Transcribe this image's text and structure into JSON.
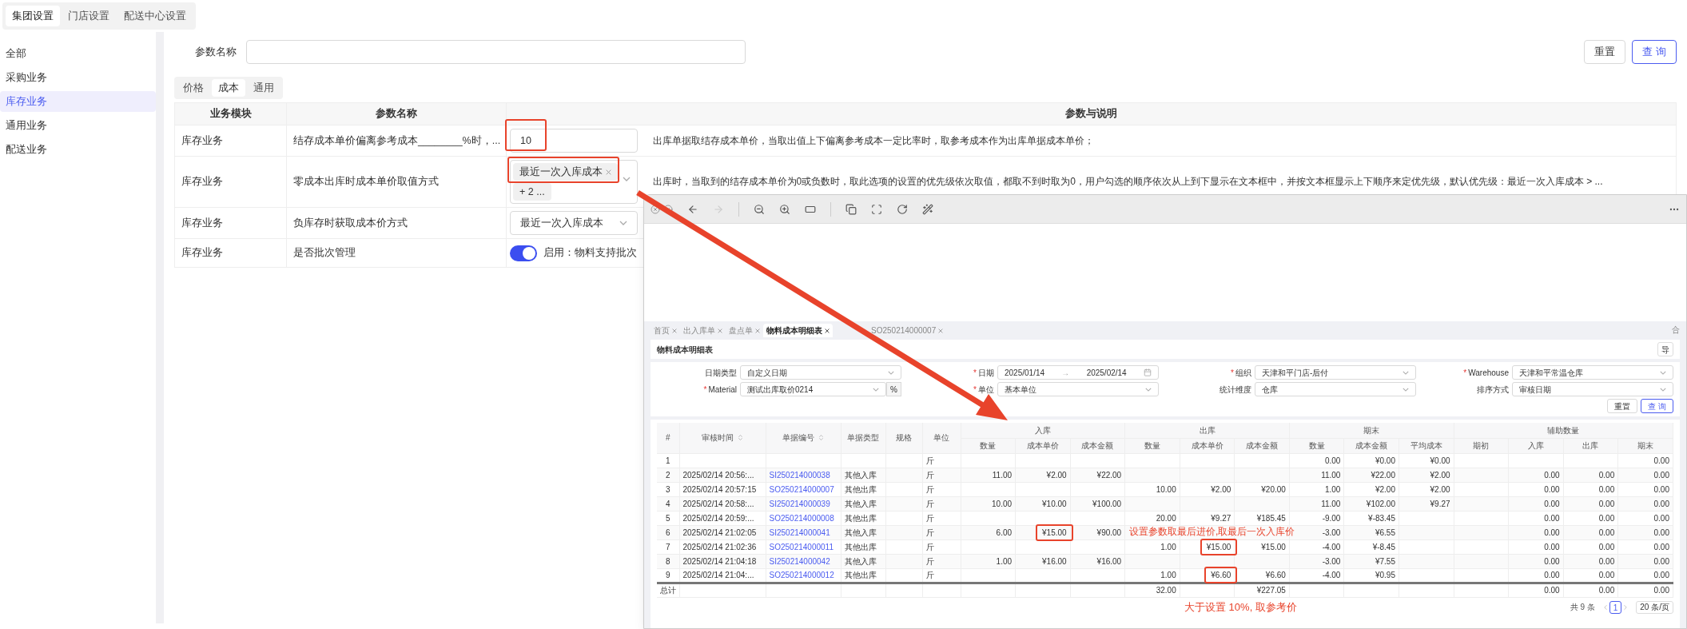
{
  "top_tabs": [
    {
      "label": "集团设置",
      "selected": true
    },
    {
      "label": "门店设置",
      "selected": false
    },
    {
      "label": "配送中心设置",
      "selected": false
    }
  ],
  "sidebar": {
    "items": [
      {
        "label": "全部",
        "selected": false
      },
      {
        "label": "采购业务",
        "selected": false
      },
      {
        "label": "库存业务",
        "selected": true
      },
      {
        "label": "通用业务",
        "selected": false
      },
      {
        "label": "配送业务",
        "selected": false
      }
    ]
  },
  "search": {
    "label": "参数名称",
    "buttons": [
      {
        "label": "重置",
        "kind": "default"
      },
      {
        "label": "查 询",
        "kind": "primary"
      }
    ]
  },
  "sub_tabs": [
    {
      "label": "价格",
      "selected": false
    },
    {
      "label": "成本",
      "selected": true
    },
    {
      "label": "通用",
      "selected": false
    }
  ],
  "params_table": {
    "columns": [
      "业务模块",
      "参数名称",
      "参数与说明"
    ],
    "rows": [
      {
        "module": "库存业务",
        "name": "结存成本单价偏离参考成本________%时，...",
        "control": {
          "kind": "input",
          "value": "10",
          "highlighted": true
        },
        "description": "出库单据取结存成本单价，当取出值上下偏离参考成本一定比率时，取参考成本作为出库单据成本单价；"
      },
      {
        "module": "库存业务",
        "name": "零成本出库时成本单价取值方式",
        "control": {
          "kind": "multiselect",
          "tags": [
            "最近一次入库成本"
          ],
          "more": "+ 2 ...",
          "highlighted": true
        },
        "description": "出库时，当取到的结存成本单价为0或负数时，取此选项的设置的优先级依次取值，都取不到时取为0，用户勾选的顺序依次从上到下显示在文本框中，并按文本框显示上下顺序来定优先级，默认优先级：最近一次入库成本 > ..."
      },
      {
        "module": "库存业务",
        "name": "负库存时获取成本价方式",
        "control": {
          "kind": "select",
          "value": "最近一次入库成本",
          "highlighted": false
        }
      },
      {
        "module": "库存业务",
        "name": "是否批次管理",
        "control": {
          "kind": "switch",
          "on": true,
          "label": "启用：物料支持批次",
          "highlighted": false
        }
      }
    ]
  },
  "viewer": {
    "report": {
      "tabs": [
        {
          "label": "首页",
          "selected": false
        },
        {
          "label": "出入库单",
          "selected": false
        },
        {
          "label": "盘点单",
          "selected": false
        },
        {
          "label": "物料成本明细表",
          "selected": true
        },
        {
          "label": "SO250214000007",
          "selected": false
        }
      ],
      "tab_bar_button": "合",
      "title": "物料成本明细表",
      "export_button": "导",
      "filters": [
        {
          "label": "日期类型",
          "required": false,
          "kind": "select",
          "value": "自定义日期"
        },
        {
          "label": "日期",
          "required": true,
          "required_mark": "*",
          "kind": "range",
          "from": "2025/01/14",
          "separator": "→",
          "to": "2025/02/14"
        },
        {
          "label": "组织",
          "required": true,
          "required_mark": "*",
          "kind": "select",
          "value": "天津和平门店-后付"
        },
        {
          "label": "Warehouse",
          "required": true,
          "required_mark": "*",
          "kind": "select",
          "value": "天津和平常温仓库"
        },
        {
          "label": "Material",
          "required": true,
          "required_mark": "*",
          "kind": "select",
          "value": "测试出库取价0214",
          "suffix": "%"
        },
        {
          "label": "单位",
          "required": true,
          "required_mark": "*",
          "kind": "select",
          "value": "基本单位"
        },
        {
          "label": "统计维度",
          "required": false,
          "kind": "select",
          "value": "仓库"
        },
        {
          "label": "排序方式",
          "required": false,
          "kind": "select",
          "value": "审核日期"
        }
      ],
      "buttons": [
        {
          "label": "重置",
          "kind": "default"
        },
        {
          "label": "查 询",
          "kind": "primary"
        }
      ],
      "table": {
        "columns": [
          {
            "label": "#",
            "kind": "index",
            "sortable": false
          },
          {
            "label": "审核时间",
            "kind": "text",
            "sortable": true
          },
          {
            "label": "单据编号",
            "kind": "link",
            "sortable": true
          },
          {
            "label": "单据类型",
            "kind": "text",
            "sortable": false
          },
          {
            "label": "规格",
            "kind": "text",
            "sortable": false
          },
          {
            "label": "单位",
            "kind": "unit",
            "sortable": false
          },
          {
            "label": "入库",
            "kind": "group",
            "colspan": 3,
            "sortable": false,
            "children": [
              "数量",
              "成本单价",
              "成本金额"
            ]
          },
          {
            "label": "出库",
            "kind": "group",
            "colspan": 3,
            "sortable": false,
            "children": [
              "数量",
              "成本单价",
              "成本金额"
            ]
          },
          {
            "label": "期末",
            "kind": "group",
            "colspan": 3,
            "sortable": false,
            "children": [
              "数量",
              "成本金额",
              "平均成本"
            ]
          },
          {
            "label": "辅助数量",
            "kind": "group",
            "colspan": 4,
            "sortable": false,
            "children": [
              "期初",
              "入库",
              "出库",
              "期末"
            ]
          }
        ],
        "rows": [
          [
            "1",
            null,
            null,
            null,
            null,
            "斤",
            null,
            null,
            null,
            null,
            null,
            null,
            "0.00",
            "¥0.00",
            "¥0.00",
            null,
            null,
            null,
            "0.00"
          ],
          [
            "2",
            "2025/02/14 20:56:...",
            "SI250214000038",
            "其他入库",
            null,
            "斤",
            "11.00",
            "¥2.00",
            "¥22.00",
            null,
            null,
            null,
            "11.00",
            "¥22.00",
            "¥2.00",
            null,
            "0.00",
            "0.00",
            "0.00"
          ],
          [
            "3",
            "2025/02/14 20:57:15",
            "SO250214000007",
            "其他出库",
            null,
            "斤",
            null,
            null,
            null,
            "10.00",
            "¥2.00",
            "¥20.00",
            "1.00",
            "¥2.00",
            "¥2.00",
            null,
            "0.00",
            "0.00",
            "0.00"
          ],
          [
            "4",
            "2025/02/14 20:58:...",
            "SI250214000039",
            "其他入库",
            null,
            "斤",
            "10.00",
            "¥10.00",
            "¥100.00",
            null,
            null,
            null,
            "11.00",
            "¥102.00",
            "¥9.27",
            null,
            "0.00",
            "0.00",
            "0.00"
          ],
          [
            "5",
            "2025/02/14 20:59:...",
            "SO250214000008",
            "其他出库",
            null,
            "斤",
            null,
            null,
            null,
            "20.00",
            "¥9.27",
            "¥185.45",
            "-9.00",
            "¥-83.45",
            null,
            null,
            "0.00",
            "0.00",
            "0.00"
          ],
          [
            "6",
            "2025/02/14 21:02:05",
            "SI250214000041",
            "其他入库",
            null,
            "斤",
            "6.00",
            {
              "text": "¥15.00",
              "highlighted": true
            },
            "¥90.00",
            null,
            null,
            null,
            "-3.00",
            "¥6.55",
            null,
            null,
            "0.00",
            "0.00",
            "0.00"
          ],
          [
            "7",
            "2025/02/14 21:02:36",
            "SO250214000011",
            "其他出库",
            null,
            "斤",
            null,
            null,
            null,
            "1.00",
            {
              "text": "¥15.00",
              "highlighted": true
            },
            "¥15.00",
            "-4.00",
            "¥-8.45",
            null,
            null,
            "0.00",
            "0.00",
            "0.00"
          ],
          [
            "8",
            "2025/02/14 21:04:18",
            "SI250214000042",
            "其他入库",
            null,
            "斤",
            "1.00",
            "¥16.00",
            "¥16.00",
            null,
            null,
            null,
            "-3.00",
            "¥7.55",
            null,
            null,
            "0.00",
            "0.00",
            "0.00"
          ],
          [
            "9",
            "2025/02/14 21:04:...",
            "SO250214000012",
            "其他出库",
            null,
            "斤",
            null,
            null,
            null,
            "1.00",
            {
              "text": "¥6.60",
              "highlighted": true
            },
            "¥6.60",
            "-4.00",
            "¥0.95",
            null,
            null,
            "0.00",
            "0.00",
            "0.00"
          ]
        ],
        "total": {
          "label": "总计",
          "out_quantity": "32.00",
          "out_amount": "¥227.05",
          "aux_in": "0.00",
          "aux_out": "0.00",
          "aux_end": "0.00"
        }
      },
      "pagination": {
        "total": "共 9 条",
        "pages": [
          {
            "label": "1",
            "selected": true
          }
        ],
        "page_size": "20 条/页"
      }
    },
    "annotations": [
      "设置参数取最后进价,取最后一次入库价",
      "大于设置 10%, 取参考价"
    ]
  }
}
